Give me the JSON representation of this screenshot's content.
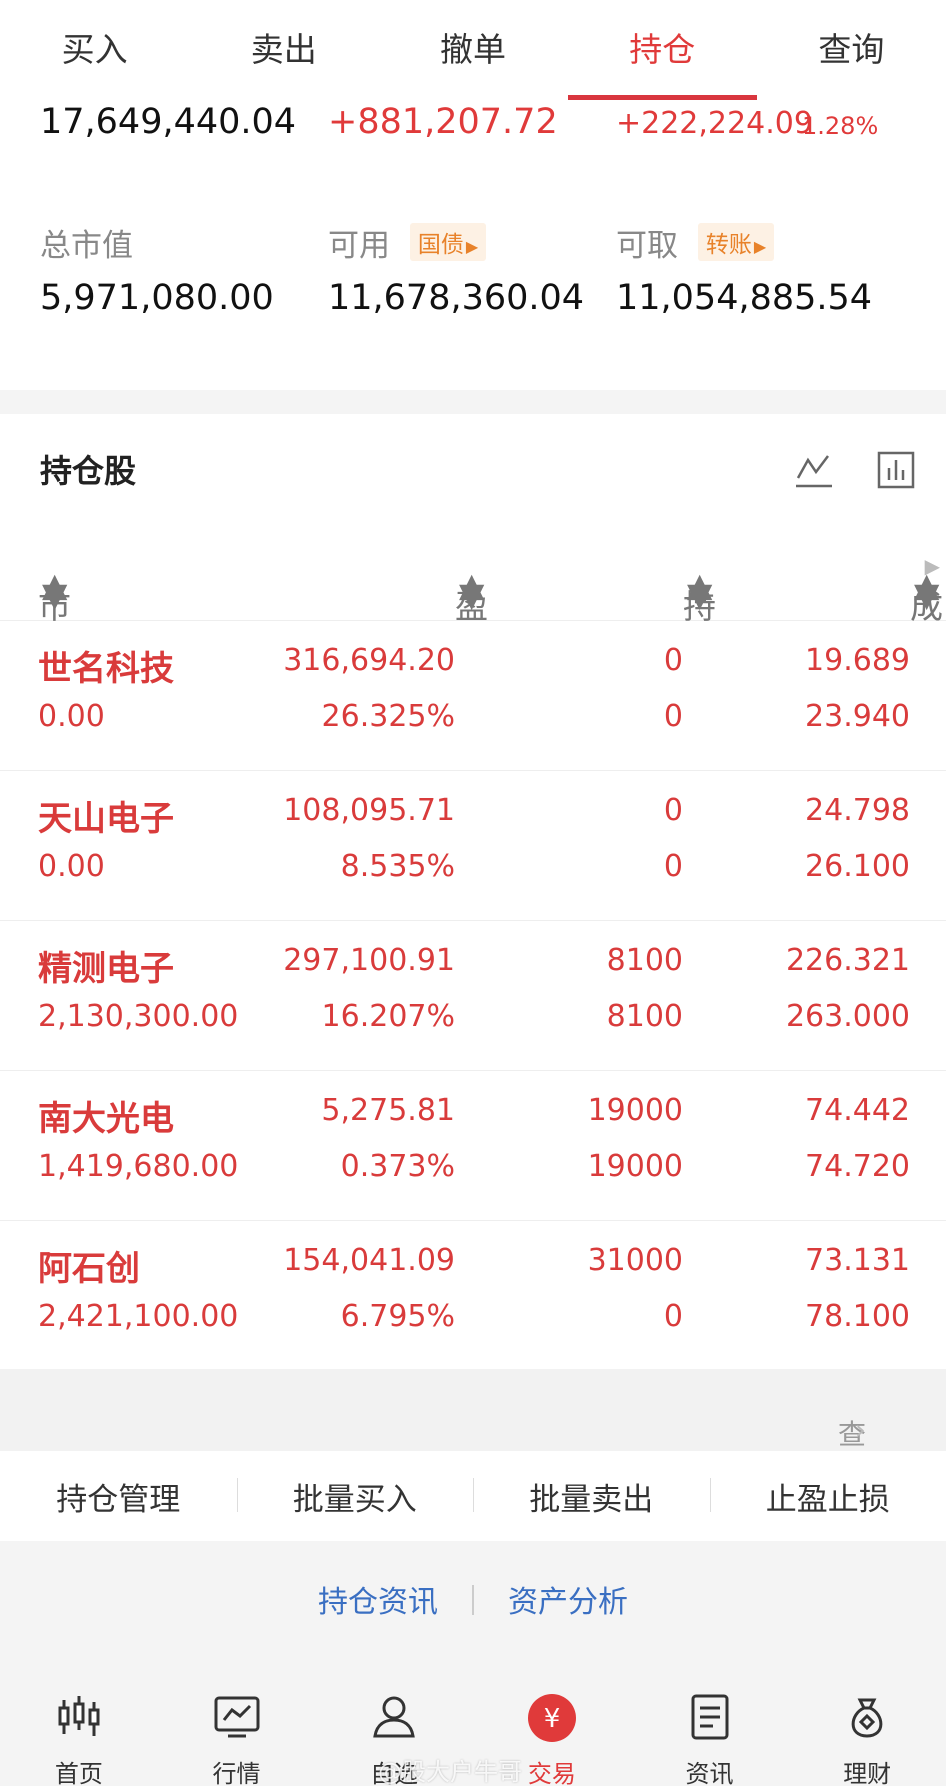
{
  "tabs": [
    "买入",
    "卖出",
    "撤单",
    "持仓",
    "查询"
  ],
  "summary": {
    "total_assets": "17,649,440.04",
    "float_pl": "+881,207.72",
    "today_pl": "+222,224.09",
    "today_pl_pct": "1.28%",
    "market_value_label": "总市值",
    "market_value": "5,971,080.00",
    "available_label": "可用",
    "available_tag": "国债",
    "available": "11,678,360.04",
    "withdrawable_label": "可取",
    "withdrawable_tag": "转账",
    "withdrawable": "11,054,885.54"
  },
  "holdings": {
    "title": "持仓股",
    "columns": [
      "市值",
      "盈亏",
      "持仓/可用",
      "成本/现价"
    ],
    "rows": [
      {
        "name": "世名科技",
        "market_value": "0.00",
        "pl": "316,694.20",
        "pl_pct": "26.325%",
        "position": "0",
        "available": "0",
        "cost": "19.689",
        "price": "23.940"
      },
      {
        "name": "天山电子",
        "market_value": "0.00",
        "pl": "108,095.71",
        "pl_pct": "8.535%",
        "position": "0",
        "available": "0",
        "cost": "24.798",
        "price": "26.100"
      },
      {
        "name": "精测电子",
        "market_value": "2,130,300.00",
        "pl": "297,100.91",
        "pl_pct": "16.207%",
        "position": "8100",
        "available": "8100",
        "cost": "226.321",
        "price": "263.000"
      },
      {
        "name": "南大光电",
        "market_value": "1,419,680.00",
        "pl": "5,275.81",
        "pl_pct": "0.373%",
        "position": "19000",
        "available": "19000",
        "cost": "74.442",
        "price": "74.720"
      },
      {
        "name": "阿石创",
        "market_value": "2,421,100.00",
        "pl": "154,041.09",
        "pl_pct": "6.795%",
        "position": "31000",
        "available": "0",
        "cost": "73.131",
        "price": "78.100"
      }
    ],
    "cleared_link": "查看已清仓股票"
  },
  "actions": [
    "持仓管理",
    "批量买入",
    "批量卖出",
    "止盈止损"
  ],
  "links": [
    "持仓资讯",
    "资产分析"
  ],
  "bottom_nav": [
    "首页",
    "行情",
    "自选",
    "交易",
    "资讯",
    "理财"
  ],
  "watermark": "@股大户牛哥",
  "colors": {
    "accent": "#e03a3a",
    "link": "#3a6fc2",
    "tag": "#e8822a"
  }
}
